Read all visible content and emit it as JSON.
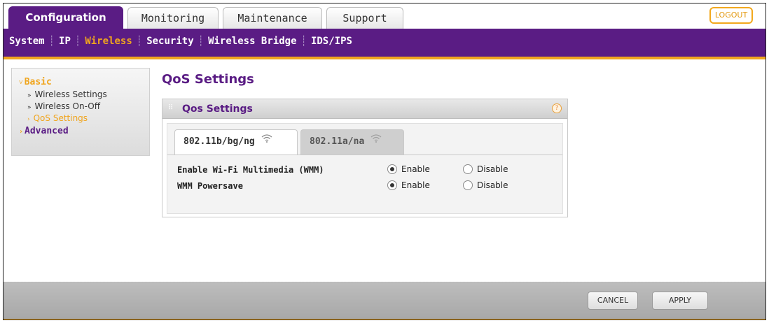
{
  "tabs": [
    {
      "label": "Configuration",
      "active": true
    },
    {
      "label": "Monitoring",
      "active": false
    },
    {
      "label": "Maintenance",
      "active": false
    },
    {
      "label": "Support",
      "active": false
    }
  ],
  "logout_label": "LOGOUT",
  "subnav": {
    "items": [
      {
        "label": "System",
        "active": false
      },
      {
        "label": "IP",
        "active": false
      },
      {
        "label": "Wireless",
        "active": true
      },
      {
        "label": "Security",
        "active": false
      },
      {
        "label": "Wireless Bridge",
        "active": false
      },
      {
        "label": "IDS/IPS",
        "active": false
      }
    ]
  },
  "sidebar": {
    "basic_label": "Basic",
    "items": [
      {
        "label": "Wireless Settings",
        "active": false
      },
      {
        "label": "Wireless On-Off",
        "active": false
      },
      {
        "label": "QoS Settings",
        "active": true
      }
    ],
    "advanced_label": "Advanced"
  },
  "page_title": "QoS Settings",
  "panel": {
    "title": "Qos Settings",
    "help_icon": "?",
    "radio_tabs": [
      {
        "label": "802.11b/bg/ng",
        "active": true
      },
      {
        "label": "802.11a/na",
        "active": false
      }
    ],
    "rows": [
      {
        "label": "Enable Wi-Fi Multimedia (WMM)",
        "enable_label": "Enable",
        "disable_label": "Disable",
        "value": "Enable"
      },
      {
        "label": "WMM Powersave",
        "enable_label": "Enable",
        "disable_label": "Disable",
        "value": "Enable"
      }
    ]
  },
  "footer": {
    "cancel_label": "CANCEL",
    "apply_label": "APPLY"
  },
  "colors": {
    "brand_purple": "#5a1c84",
    "accent_orange": "#f0a51e"
  }
}
